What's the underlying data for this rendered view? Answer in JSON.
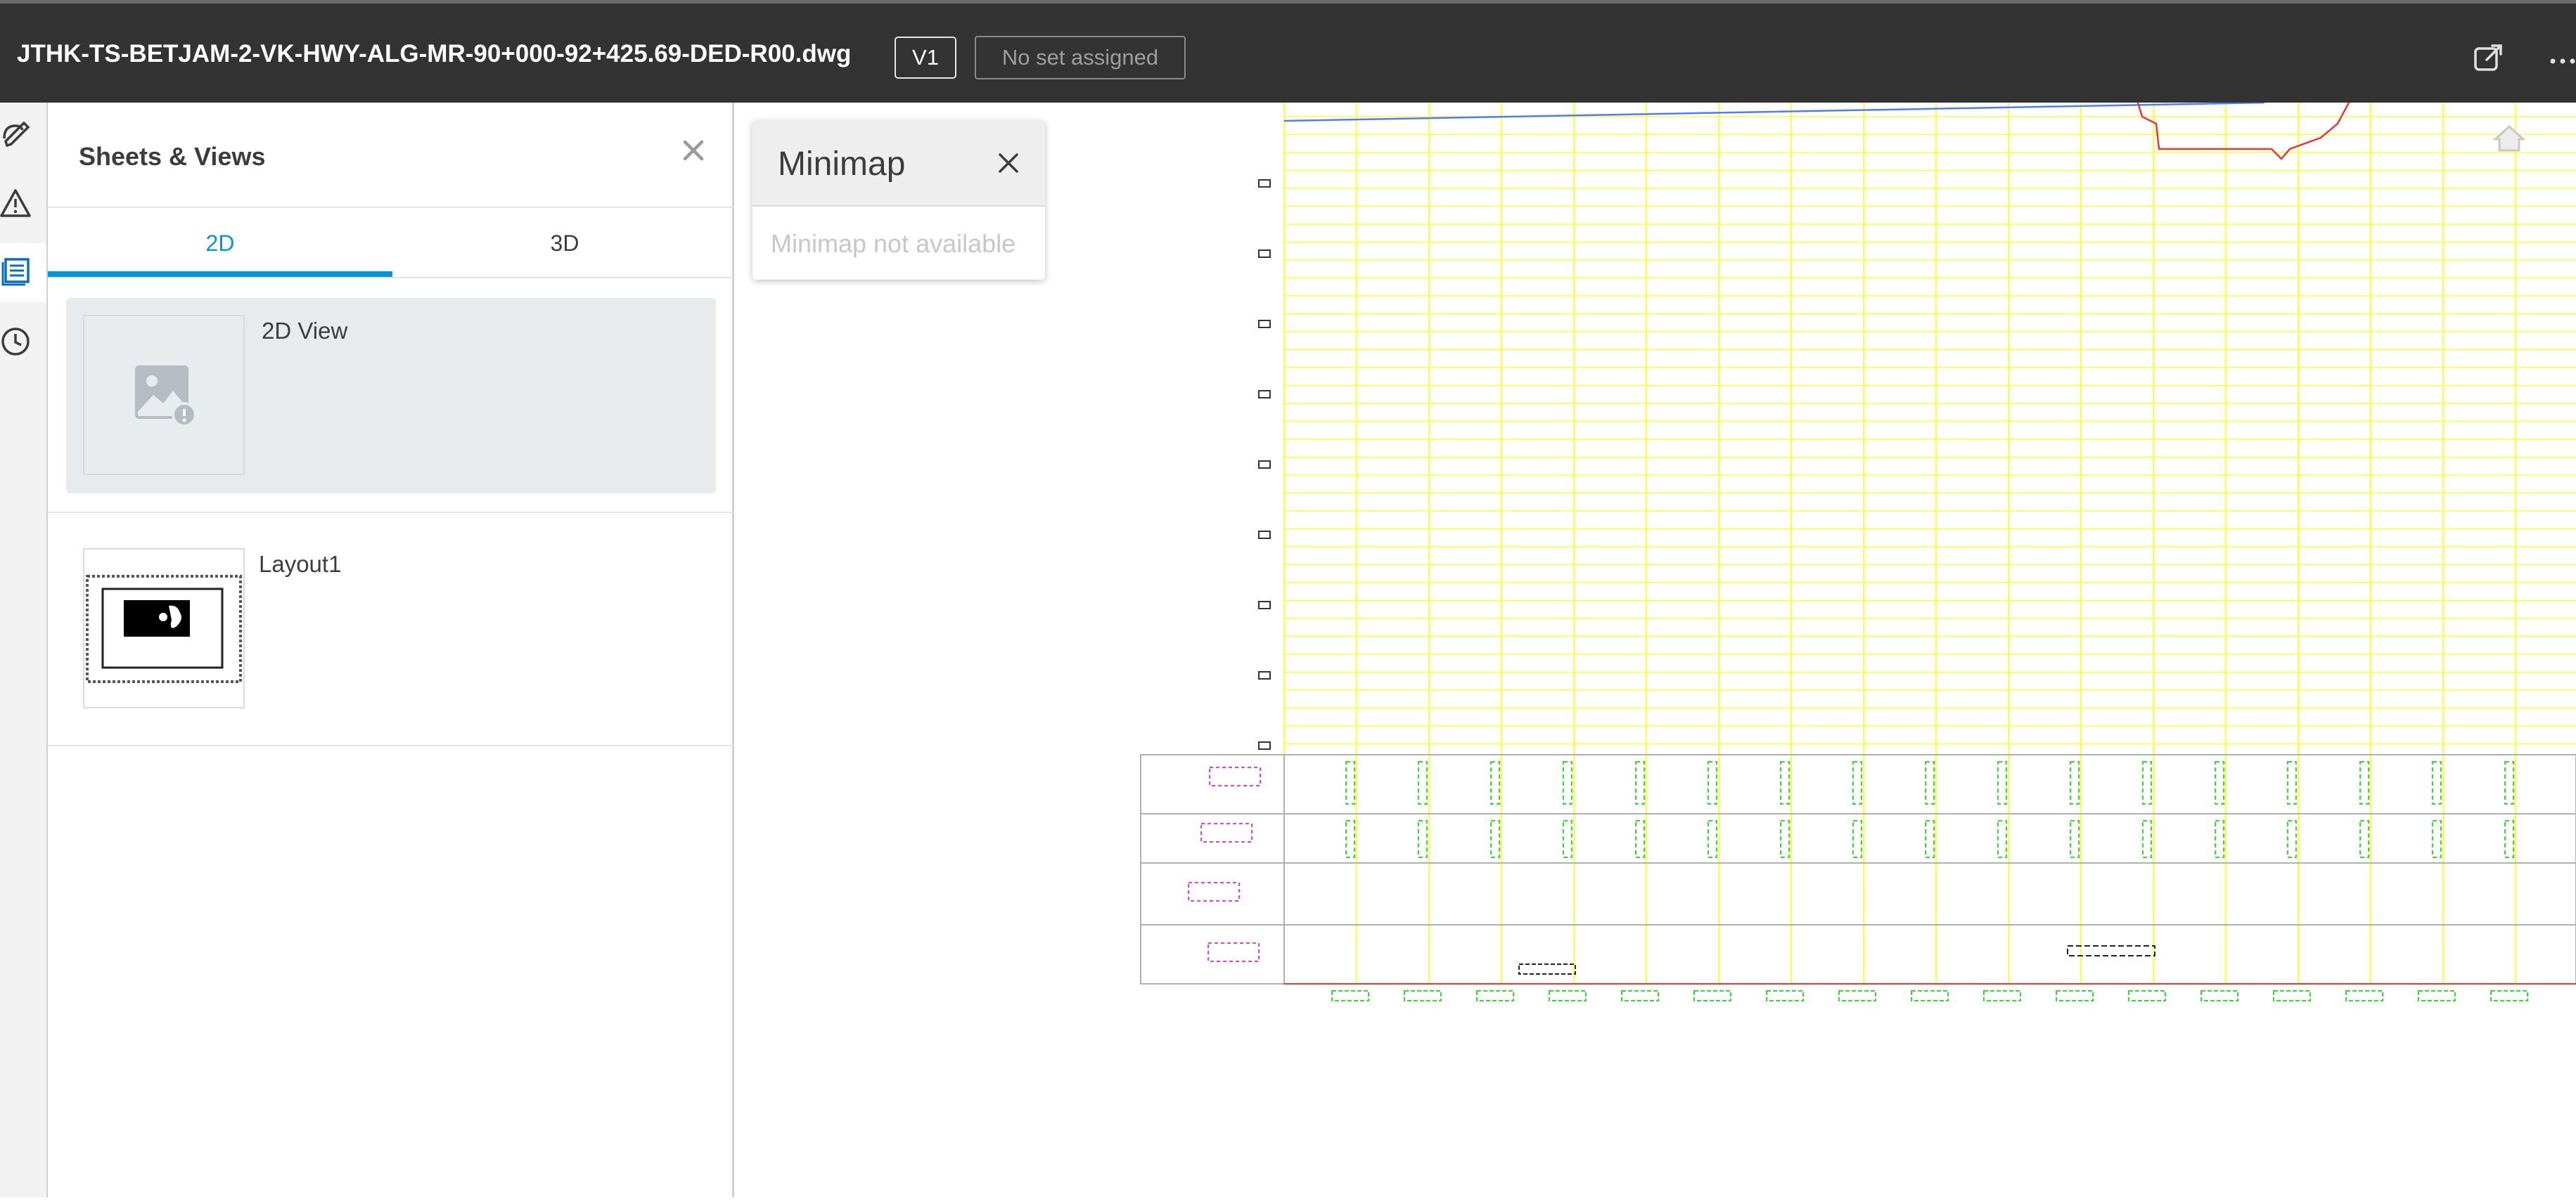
{
  "header": {
    "file_name": "JTHK-TS-BETJAM-2-VK-HWY-ALG-MR-90+000-92+425.69-DED-R00.dwg",
    "version": "V1",
    "set_status": "No set assigned",
    "icons": [
      "open-new-window-icon",
      "more-options-icon"
    ]
  },
  "rail": {
    "items": [
      {
        "icon": "markup-icon",
        "active": false
      },
      {
        "icon": "issues-warning-icon",
        "active": false
      },
      {
        "icon": "sheets-views-icon",
        "active": true
      },
      {
        "icon": "history-clock-icon",
        "active": false
      }
    ]
  },
  "panel": {
    "title": "Sheets & Views",
    "tabs": [
      {
        "label": "2D",
        "active": true
      },
      {
        "label": "3D",
        "active": false
      }
    ],
    "views": [
      {
        "label": "2D View",
        "selected": true,
        "thumbnail": "image-placeholder-icon"
      },
      {
        "label": "Layout1",
        "selected": false,
        "thumbnail": "layout-thumbnail"
      }
    ]
  },
  "minimap": {
    "title": "Minimap",
    "message": "Minimap not available"
  },
  "canvas": {
    "grid_color": "#ffff33",
    "band_label_color": "#e040e0",
    "band_value_color": "#33dd33",
    "profile_color": "#e53935",
    "alignment_color": "#4f7cff",
    "home_icon": "home-view-icon"
  },
  "colors": {
    "accent": "#0696d7",
    "header_bg": "#333333"
  }
}
